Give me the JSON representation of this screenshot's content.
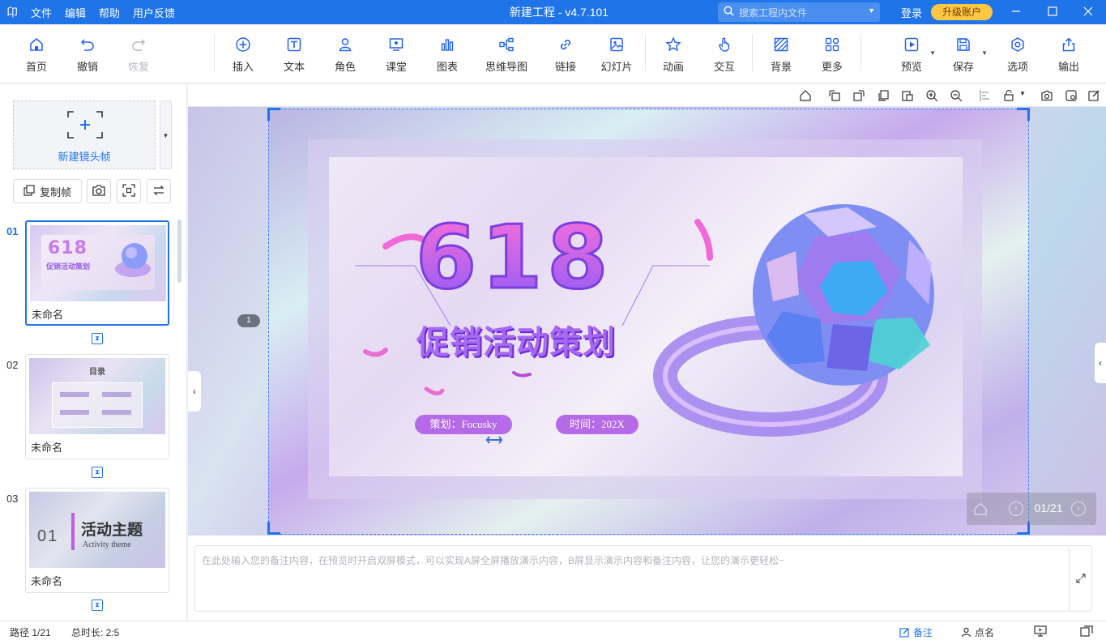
{
  "titlebar": {
    "logo": "卬",
    "menu": [
      "文件",
      "编辑",
      "帮助",
      "用户反馈"
    ],
    "title": "新建工程 - v4.7.101",
    "search_placeholder": "搜索工程内文件",
    "login": "登录",
    "upgrade": "升级账户"
  },
  "toolbar": {
    "home": "首页",
    "undo": "撤销",
    "redo": "恢复",
    "insert": "插入",
    "text": "文本",
    "role": "角色",
    "classroom": "课堂",
    "chart": "图表",
    "mindmap": "思维导图",
    "link": "链接",
    "slideshow": "幻灯片",
    "animation": "动画",
    "interaction": "交互",
    "background": "背景",
    "more": "更多",
    "preview": "预览",
    "save": "保存",
    "options": "选项",
    "export": "输出"
  },
  "left": {
    "new_frame": "新建镜头帧",
    "copy_frame": "复制帧",
    "slides": [
      {
        "num": "01",
        "name": "未命名"
      },
      {
        "num": "02",
        "name": "未命名"
      },
      {
        "num": "03",
        "name": "未命名"
      }
    ],
    "thumb2_title": "目录",
    "thumb3_num": "01",
    "thumb3_title": "活动主题",
    "thumb3_sub": "Activity theme"
  },
  "slide": {
    "big": "618",
    "subtitle": "促销活动策划",
    "planner": "策划：Focusky",
    "time": "时间：202X",
    "frame_badge": "1"
  },
  "nav": {
    "counter": "01/21"
  },
  "notes": {
    "placeholder": "在此处输入您的备注内容，在预览时开启双屏模式，可以实现A屏全屏播放演示内容，B屏显示演示内容和备注内容，让您的演示更轻松~"
  },
  "status": {
    "path": "路径 1/21",
    "duration": "总时长: 2:5",
    "notes": "备注",
    "rollcall": "点名"
  },
  "colors": {
    "accent": "#1f74e8",
    "upgrade": "#ffc742",
    "pill": "#b56ae8"
  }
}
